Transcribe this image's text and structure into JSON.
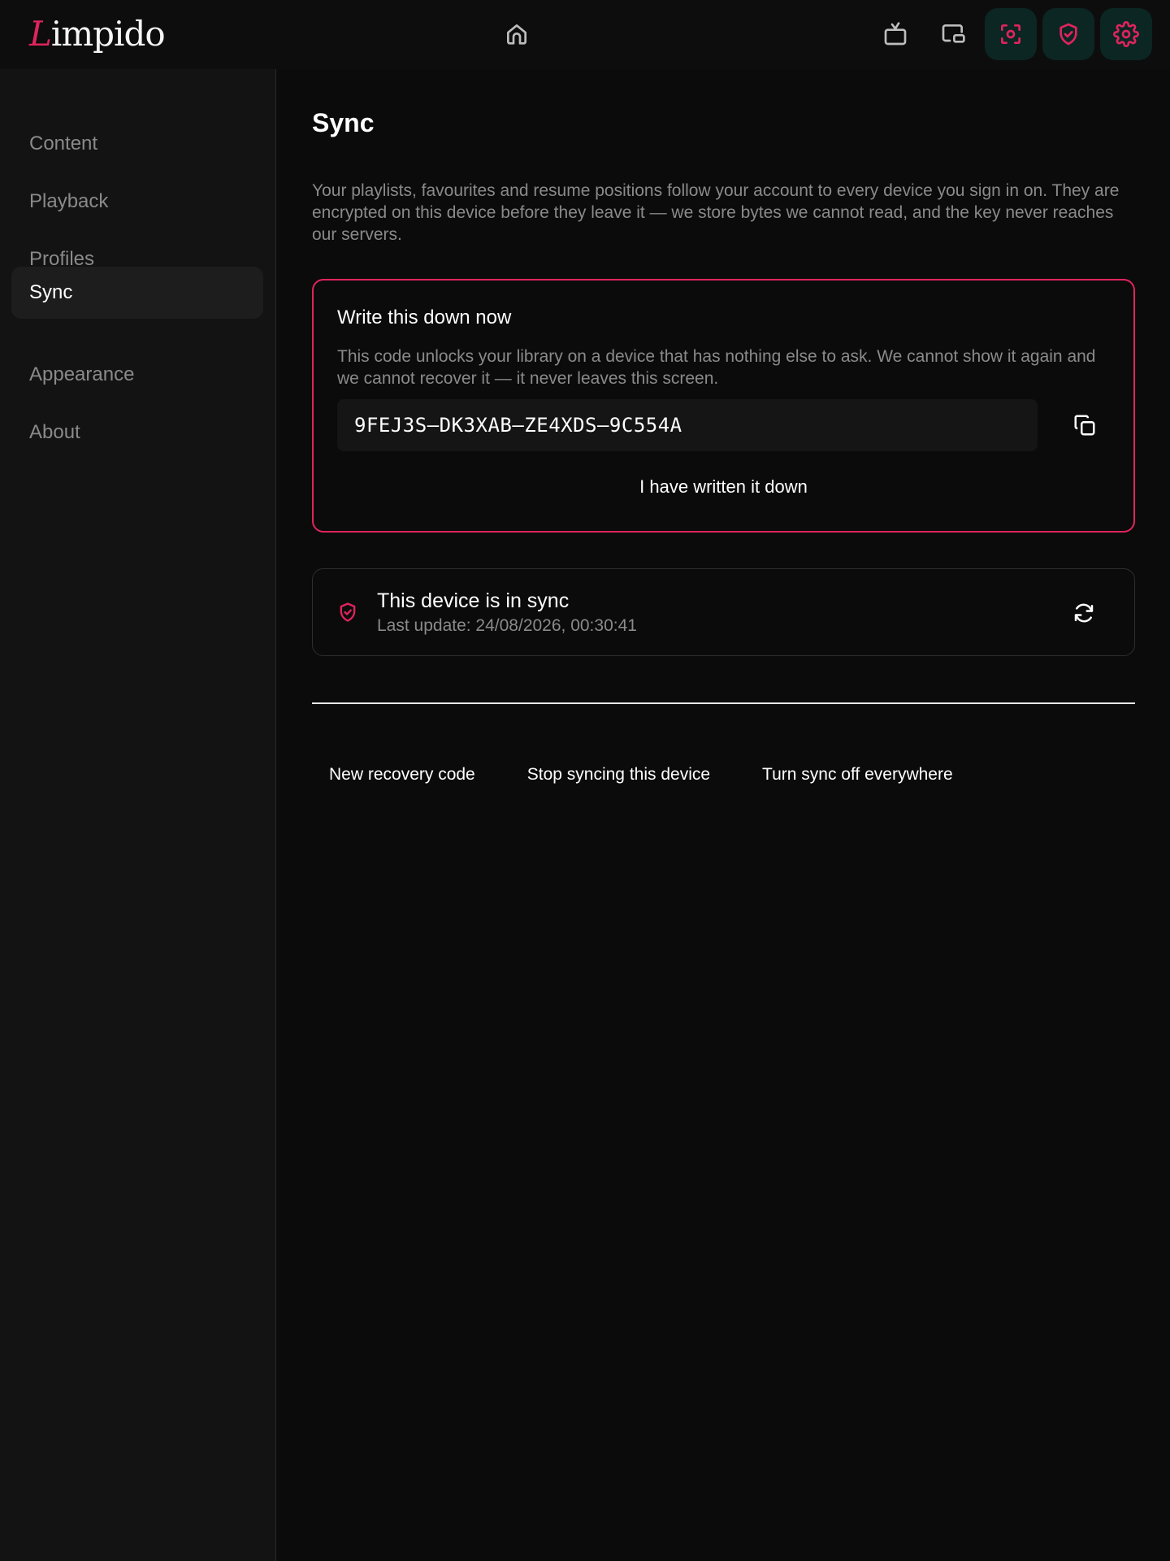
{
  "app": {
    "logo_initial": "L",
    "logo_rest": "impido",
    "accent_color": "#e0245e"
  },
  "topbar": {
    "icons": [
      "home-icon",
      "tv-icon",
      "picture-in-picture-icon",
      "focus-scan-icon",
      "shield-check-icon",
      "gear-icon"
    ]
  },
  "sidebar": {
    "items": [
      {
        "label": "Content"
      },
      {
        "label": "Playback"
      },
      {
        "label": "Profiles"
      },
      {
        "label": "Sync"
      },
      {
        "label": "Appearance"
      },
      {
        "label": "About"
      }
    ],
    "selected": "Sync"
  },
  "main": {
    "title": "Sync",
    "intro": "Your playlists, favourites and resume positions follow your account to every device you sign in on. They are encrypted on this device before they leave it — we store bytes we cannot read, and the key never reaches our servers.",
    "recovery": {
      "title": "Write this down now",
      "text": "This code unlocks your library on a device that has nothing else to ask. We cannot show it again and we cannot recover it — it never leaves this screen.",
      "code": "9FEJ3S–DK3XAB–ZE4XDS–9C554A",
      "confirm_label": "I have written it down"
    },
    "status": {
      "title": "This device is in sync",
      "subtitle": "Last update: 24/08/2026, 00:30:41"
    },
    "actions": {
      "new_code": "New recovery code",
      "stop_device": "Stop syncing this device",
      "off_everywhere": "Turn sync off everywhere"
    }
  }
}
